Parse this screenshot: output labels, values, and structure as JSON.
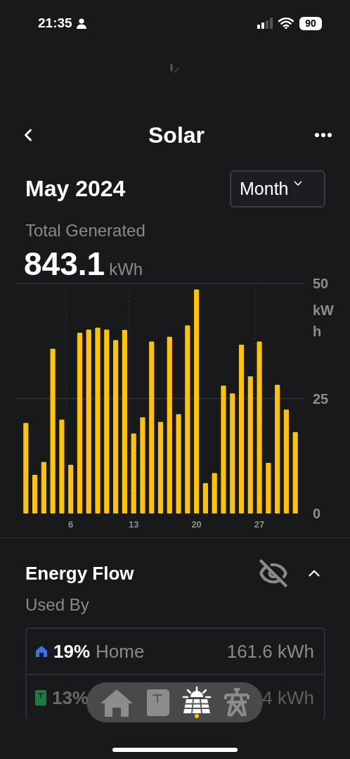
{
  "status_bar": {
    "time": "21:35",
    "battery": "90"
  },
  "header": {
    "title": "Solar"
  },
  "period": {
    "label": "May 2024",
    "range": "Month"
  },
  "total": {
    "label": "Total Generated",
    "value": "843.1",
    "unit": "kWh"
  },
  "chart_data": {
    "type": "bar",
    "ylabel": "kWh",
    "x": [
      1,
      2,
      3,
      4,
      5,
      6,
      7,
      8,
      9,
      10,
      11,
      12,
      13,
      14,
      15,
      16,
      17,
      18,
      19,
      20,
      21,
      22,
      23,
      24,
      25,
      26,
      27,
      28,
      29,
      30,
      31
    ],
    "series": [
      {
        "color": "#ffc20e",
        "values": [
          19.7,
          8.4,
          11.2,
          35.8,
          20.4,
          10.6,
          39.3,
          40.0,
          40.4,
          40.0,
          37.7,
          39.9,
          17.4,
          20.9,
          37.4,
          19.9,
          38.4,
          21.6,
          40.9,
          48.7,
          6.6,
          8.8,
          27.8,
          26.1,
          36.7,
          29.8,
          37.4,
          11.0,
          28.0,
          22.6,
          17.7
        ]
      }
    ],
    "xlim": [
      0,
      32
    ],
    "ylim": [
      0,
      50
    ],
    "yticks": [
      0,
      25,
      50
    ],
    "xticks": [
      6,
      13,
      20,
      27
    ]
  },
  "energy_flow": {
    "title": "Energy Flow",
    "expanded": true,
    "subtitle": "Used By",
    "rows": [
      {
        "kind": "home",
        "percent": "19%",
        "label": "Home",
        "value": "161.6 kWh",
        "color": "#3a6ff0"
      },
      {
        "kind": "powerwall",
        "percent": "13%",
        "value": ".4 kWh",
        "color": "#1e7a45"
      }
    ]
  },
  "dock": [
    {
      "kind": "home",
      "selected": false
    },
    {
      "kind": "powerwall",
      "selected": false
    },
    {
      "kind": "solar",
      "selected": true
    },
    {
      "kind": "grid",
      "selected": false
    }
  ]
}
